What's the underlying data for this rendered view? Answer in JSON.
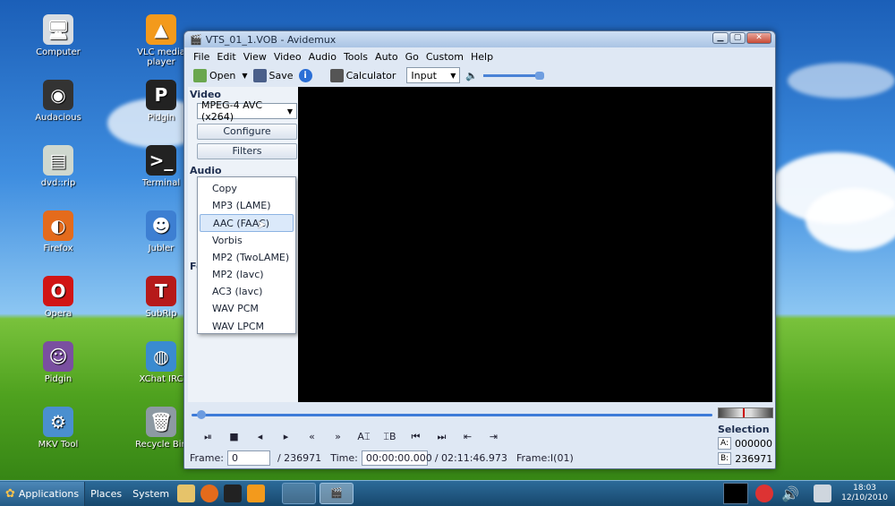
{
  "desktop": {
    "icons": [
      {
        "label": "Computer",
        "glyph": "🖥",
        "bg": "#d8dde2"
      },
      {
        "label": "VLC media player",
        "glyph": "▲",
        "bg": "#f39a1c"
      },
      {
        "label": "Audacious",
        "glyph": "◉",
        "bg": "#333"
      },
      {
        "label": "Pidgin",
        "glyph": "P",
        "bg": "#222"
      },
      {
        "label": "dvd::rip",
        "glyph": "▤",
        "bg": "#cfd8cf"
      },
      {
        "label": "Terminal",
        "glyph": ">_",
        "bg": "#222"
      },
      {
        "label": "Firefox",
        "glyph": "◐",
        "bg": "#e46b1c"
      },
      {
        "label": "Jubler",
        "glyph": "☻",
        "bg": "#3d7fd2"
      },
      {
        "label": "Opera",
        "glyph": "O",
        "bg": "#d11515"
      },
      {
        "label": "SubRip",
        "glyph": "T",
        "bg": "#b61a1a"
      },
      {
        "label": "Pidgin",
        "glyph": "☺",
        "bg": "#7a4fa0"
      },
      {
        "label": "XChat IRC",
        "glyph": "◍",
        "bg": "#3a8bd0"
      },
      {
        "label": "MKV Tool",
        "glyph": "⚙",
        "bg": "#4a8fcf"
      },
      {
        "label": "Recycle Bin",
        "glyph": "🗑",
        "bg": "#8d9aa3"
      }
    ]
  },
  "window": {
    "title": "VTS_01_1.VOB - Avidemux",
    "menu": [
      "File",
      "Edit",
      "View",
      "Video",
      "Audio",
      "Tools",
      "Auto",
      "Go",
      "Custom",
      "Help"
    ],
    "toolbar": {
      "open_label": "Open",
      "save_label": "Save",
      "calculator_label": "Calculator",
      "input_select": "Input"
    },
    "left": {
      "video_header": "Video",
      "video_codec": "MPEG-4 AVC (x264)",
      "configure_label": "Configure",
      "filters_label": "Filters",
      "audio_header": "Audio",
      "format_header_fragment": "Fo"
    },
    "audio_dropdown": {
      "items": [
        "Copy",
        "MP3 (LAME)",
        "AAC (FAAC)",
        "Vorbis",
        "MP2 (TwoLAME)",
        "MP2 (lavc)",
        "AC3 (lavc)",
        "WAV PCM",
        "WAV LPCM"
      ],
      "highlighted_index": 2
    },
    "transport": {
      "a_marker": "A",
      "b_marker": "B"
    },
    "status": {
      "frame_label": "Frame:",
      "frame_value": "0",
      "total_frames": "/ 236971",
      "time_label": "Time:",
      "time_value": "00:00:00.000",
      "total_time": "/ 02:11:46.973",
      "frame_type": "Frame:I(01)"
    },
    "selection": {
      "header": "Selection",
      "a_label": "A:",
      "a_value": "000000",
      "b_label": "B:",
      "b_value": "236971"
    },
    "timeline_progress": 0.01
  },
  "taskbar": {
    "applications_label": "Applications",
    "places_label": "Places",
    "system_label": "System",
    "clock_time": "18:03",
    "clock_date": "12/10/2010"
  }
}
